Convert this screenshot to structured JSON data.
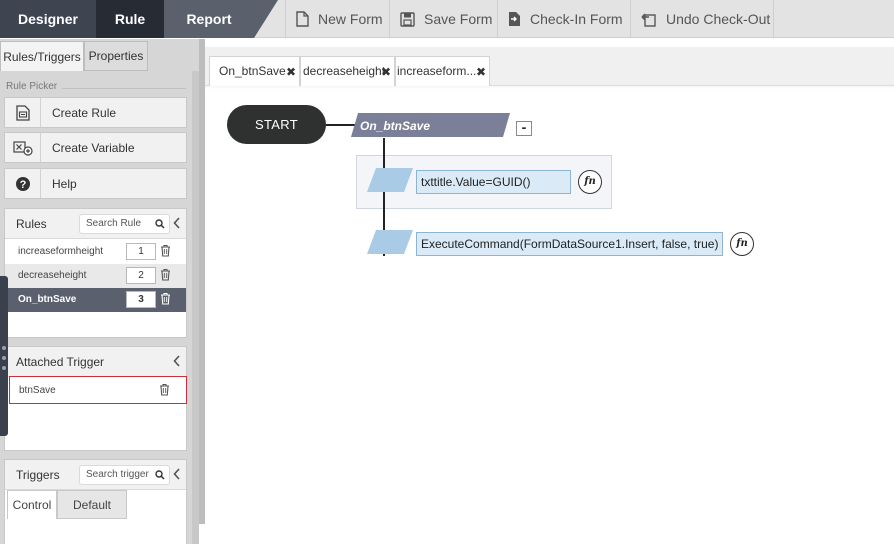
{
  "top_bar": {
    "modes": [
      {
        "label": "Designer"
      },
      {
        "label": "Rule"
      },
      {
        "label": "Report"
      }
    ],
    "tools": [
      {
        "label": "New Form",
        "icon": "new-form-icon"
      },
      {
        "label": "Save Form",
        "icon": "save-icon"
      },
      {
        "label": "Check-In Form",
        "icon": "check-in-icon"
      },
      {
        "label": "Undo Check-Out",
        "icon": "undo-icon"
      }
    ]
  },
  "left_panel": {
    "tabs": [
      {
        "label": "Rules/Triggers"
      },
      {
        "label": "Properties"
      }
    ],
    "rule_picker_label": "Rule Picker",
    "picker_buttons": [
      {
        "label": "Create Rule",
        "icon": "create-rule-icon"
      },
      {
        "label": "Create Variable",
        "icon": "create-variable-icon"
      },
      {
        "label": "Help",
        "icon": "help-icon"
      }
    ],
    "rules": {
      "title": "Rules",
      "search_placeholder": "Search Rule",
      "items": [
        {
          "name": "increaseformheight",
          "order": "1"
        },
        {
          "name": "decreaseheight",
          "order": "2"
        },
        {
          "name": "On_btnSave",
          "order": "3"
        }
      ]
    },
    "attached_trigger": {
      "title": "Attached Trigger",
      "items": [
        {
          "name": "btnSave"
        }
      ]
    },
    "triggers": {
      "title": "Triggers",
      "search_placeholder": "Search trigger",
      "tabs": [
        {
          "label": "Control"
        },
        {
          "label": "Default"
        }
      ]
    }
  },
  "canvas": {
    "tabs": [
      {
        "label": "On_btnSave"
      },
      {
        "label": "decreaseheight"
      },
      {
        "label": "increaseform..."
      }
    ],
    "start_label": "START",
    "rule_header": "On_btnSave",
    "collapse_label": "-",
    "actions": [
      {
        "expression": "txttitle.Value=GUID()",
        "fn_label": "fn"
      },
      {
        "expression": "ExecuteCommand(FormDataSource1.Insert, false, true)",
        "fn_label": "fn"
      }
    ]
  },
  "colors": {
    "accent_dark": "#262b34",
    "rule_header": "#7b7f98",
    "expression_fill": "#daeaf6",
    "trigger_border": "#c9303c"
  }
}
